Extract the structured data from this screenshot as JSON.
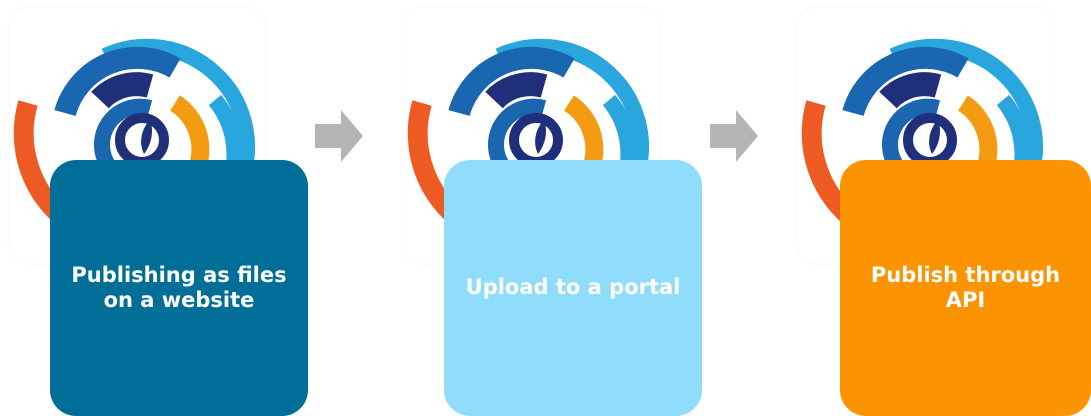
{
  "steps": [
    {
      "label": "Publishing as files\non a website",
      "color": "#006e96"
    },
    {
      "label": "Upload to a portal",
      "color": "#8fdcfb"
    },
    {
      "label": "Publish through\nAPI",
      "color": "#fb9400"
    }
  ],
  "colors": {
    "arrow": "#b5b5b5",
    "logo_light_blue": "#2aa6de",
    "logo_mid_blue": "#1a66b0",
    "logo_navy": "#1f2f7a",
    "logo_orange": "#f39c13",
    "logo_red_orange": "#ee5a24"
  },
  "icons": [
    "data-logo-icon",
    "arrow-right-icon"
  ]
}
